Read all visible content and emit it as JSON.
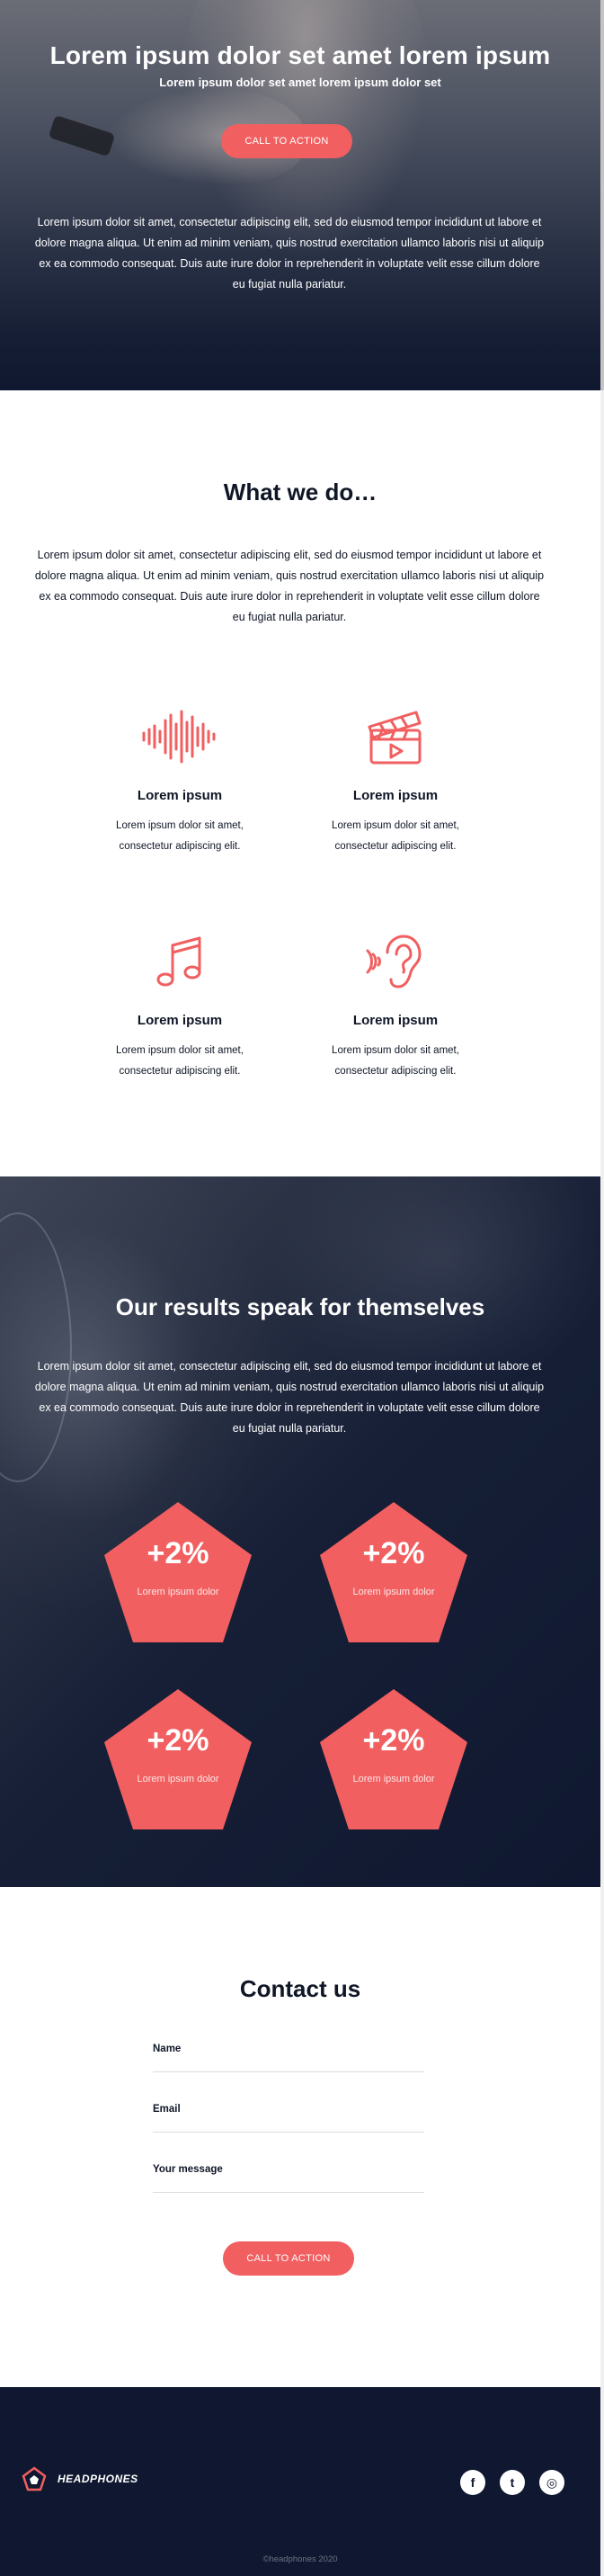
{
  "hero": {
    "title": "Lorem ipsum dolor set amet lorem ipsum",
    "subtitle": "Lorem ipsum dolor set amet lorem ipsum dolor set",
    "cta_label": "CALL TO ACTION",
    "body": "Lorem ipsum dolor sit amet, consectetur adipiscing elit, sed do eiusmod tempor incididunt ut labore et dolore magna aliqua. Ut enim ad minim veniam, quis nostrud exercitation ullamco laboris nisi ut aliquip ex ea commodo consequat. Duis aute irure dolor in reprehenderit in voluptate velit esse cillum dolore eu fugiat nulla pariatur."
  },
  "what": {
    "title": "What we do…",
    "body": "Lorem ipsum dolor sit amet, consectetur adipiscing elit, sed do eiusmod tempor incididunt ut labore et dolore magna aliqua. Ut enim ad minim veniam, quis nostrud exercitation ullamco laboris nisi ut aliquip ex ea commodo consequat. Duis aute irure dolor in reprehenderit in voluptate velit esse cillum dolore eu fugiat nulla pariatur.",
    "features": [
      {
        "icon": "sound-wave-icon",
        "title": "Lorem ipsum",
        "description": "Lorem ipsum dolor sit amet, consectetur adipiscing elit."
      },
      {
        "icon": "clapperboard-icon",
        "title": "Lorem ipsum",
        "description": "Lorem ipsum dolor sit amet, consectetur adipiscing elit."
      },
      {
        "icon": "music-note-icon",
        "title": "Lorem ipsum",
        "description": "Lorem ipsum dolor sit amet, consectetur adipiscing elit."
      },
      {
        "icon": "ear-icon",
        "title": "Lorem ipsum",
        "description": "Lorem ipsum dolor sit amet, consectetur adipiscing elit."
      }
    ]
  },
  "results": {
    "title": "Our results speak for themselves",
    "body": "Lorem ipsum dolor sit amet, consectetur adipiscing elit, sed do eiusmod tempor incididunt ut labore et dolore magna aliqua. Ut enim ad minim veniam, quis nostrud exercitation ullamco laboris nisi ut aliquip ex ea commodo consequat. Duis aute irure dolor in reprehenderit in voluptate velit esse cillum dolore eu fugiat nulla pariatur.",
    "stats": [
      {
        "value": "+2%",
        "label": "Lorem ipsum dolor"
      },
      {
        "value": "+2%",
        "label": "Lorem ipsum dolor"
      },
      {
        "value": "+2%",
        "label": "Lorem ipsum dolor"
      },
      {
        "value": "+2%",
        "label": "Lorem ipsum dolor"
      }
    ]
  },
  "contact": {
    "title": "Contact us",
    "fields": [
      {
        "label": "Name",
        "value": ""
      },
      {
        "label": "Email",
        "value": ""
      },
      {
        "label": "Your message",
        "value": ""
      }
    ],
    "cta_label": "CALL TO ACTION"
  },
  "footer": {
    "logo_text": "HEADPHONES",
    "socials": [
      {
        "icon": "facebook-icon",
        "glyph": "f"
      },
      {
        "icon": "twitter-icon",
        "glyph": "t"
      },
      {
        "icon": "instagram-icon",
        "glyph": "◎"
      }
    ],
    "copyright": "©headphones 2020"
  },
  "colors": {
    "accent": "#f15f60",
    "navy": "#0f1830",
    "text": "#0f1626"
  }
}
